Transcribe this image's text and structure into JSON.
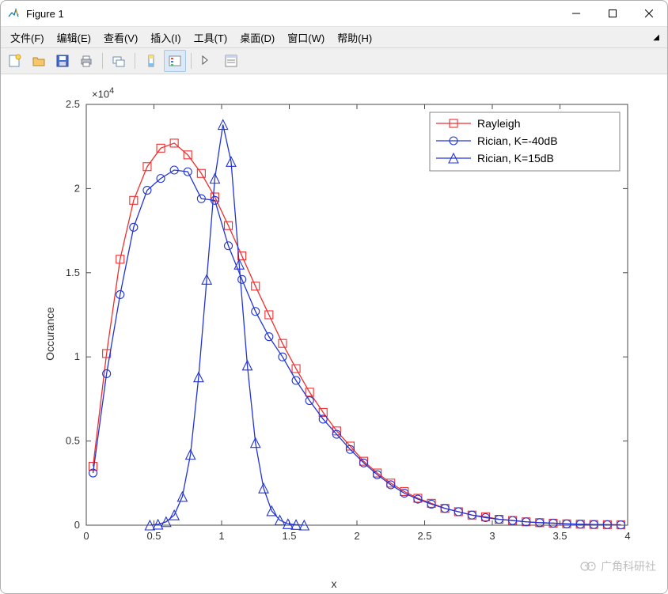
{
  "window": {
    "title": "Figure 1"
  },
  "menubar": {
    "file": "文件(F)",
    "edit": "编辑(E)",
    "view": "查看(V)",
    "insert": "插入(I)",
    "tools": "工具(T)",
    "desktop": "桌面(D)",
    "window": "窗口(W)",
    "help": "帮助(H)"
  },
  "axes": {
    "exponent": "×10",
    "exponent_sup": "4",
    "ylabel": "Occurance",
    "xlabel": "x",
    "xticks": [
      "0",
      "0.5",
      "1",
      "1.5",
      "2",
      "2.5",
      "3",
      "3.5",
      "4"
    ],
    "yticks": [
      "0",
      "0.5",
      "1",
      "1.5",
      "2",
      "2.5"
    ]
  },
  "legend": {
    "entry1": "Rayleigh",
    "entry2": "Rician, K=-40dB",
    "entry3": "Rician, K=15dB"
  },
  "colors": {
    "rayleigh": "#ef2e2e",
    "rician_low": "#2234d5",
    "rician_high": "#2234d5",
    "axis": "#4a4a4a",
    "grid_none": "#ffffff"
  },
  "watermark": "广角科研社",
  "chart_data": {
    "type": "line",
    "xlabel": "x",
    "ylabel": "Occurance",
    "y_scale": 10000,
    "xlim": [
      0,
      4
    ],
    "ylim": [
      0,
      2.5
    ],
    "legend_position": "upper-right",
    "series": [
      {
        "name": "Rayleigh",
        "marker": "square",
        "color": "#ef2e2e",
        "x": [
          0.05,
          0.15,
          0.25,
          0.35,
          0.45,
          0.55,
          0.65,
          0.75,
          0.85,
          0.95,
          1.05,
          1.15,
          1.25,
          1.35,
          1.45,
          1.55,
          1.65,
          1.75,
          1.85,
          1.95,
          2.05,
          2.15,
          2.25,
          2.35,
          2.45,
          2.55,
          2.65,
          2.75,
          2.85,
          2.95,
          3.05,
          3.15,
          3.25,
          3.35,
          3.45,
          3.55,
          3.65,
          3.75,
          3.85,
          3.95
        ],
        "y": [
          0.35,
          1.02,
          1.58,
          1.93,
          2.13,
          2.24,
          2.27,
          2.2,
          2.09,
          1.95,
          1.78,
          1.6,
          1.42,
          1.25,
          1.08,
          0.93,
          0.79,
          0.67,
          0.56,
          0.47,
          0.38,
          0.31,
          0.25,
          0.2,
          0.16,
          0.13,
          0.1,
          0.08,
          0.06,
          0.05,
          0.035,
          0.028,
          0.02,
          0.015,
          0.012,
          0.008,
          0.006,
          0.004,
          0.003,
          0.002
        ]
      },
      {
        "name": "Rician, K=-40dB",
        "marker": "circle",
        "color": "#2234d5",
        "x": [
          0.05,
          0.15,
          0.25,
          0.35,
          0.45,
          0.55,
          0.65,
          0.75,
          0.85,
          0.95,
          1.05,
          1.15,
          1.25,
          1.35,
          1.45,
          1.55,
          1.65,
          1.75,
          1.85,
          1.95,
          2.05,
          2.15,
          2.25,
          2.35,
          2.45,
          2.55,
          2.65,
          2.75,
          2.85,
          2.95,
          3.05,
          3.15,
          3.25,
          3.35,
          3.45,
          3.55,
          3.65,
          3.75,
          3.85,
          3.95
        ],
        "y": [
          0.31,
          0.9,
          1.37,
          1.77,
          1.99,
          2.06,
          2.11,
          2.1,
          1.94,
          1.93,
          1.66,
          1.46,
          1.27,
          1.12,
          1.0,
          0.86,
          0.74,
          0.63,
          0.54,
          0.45,
          0.37,
          0.3,
          0.24,
          0.19,
          0.155,
          0.125,
          0.1,
          0.08,
          0.06,
          0.045,
          0.035,
          0.028,
          0.02,
          0.015,
          0.012,
          0.008,
          0.006,
          0.004,
          0.003,
          0.002
        ]
      },
      {
        "name": "Rician, K=15dB",
        "marker": "triangle",
        "color": "#2234d5",
        "x": [
          0.47,
          0.53,
          0.59,
          0.65,
          0.71,
          0.77,
          0.83,
          0.89,
          0.95,
          1.01,
          1.07,
          1.13,
          1.19,
          1.25,
          1.31,
          1.37,
          1.43,
          1.49,
          1.55,
          1.61
        ],
        "y": [
          0.0,
          0.005,
          0.02,
          0.06,
          0.17,
          0.42,
          0.88,
          1.46,
          2.06,
          2.38,
          2.16,
          1.55,
          0.95,
          0.49,
          0.22,
          0.085,
          0.03,
          0.008,
          0.003,
          0.0
        ]
      }
    ]
  }
}
